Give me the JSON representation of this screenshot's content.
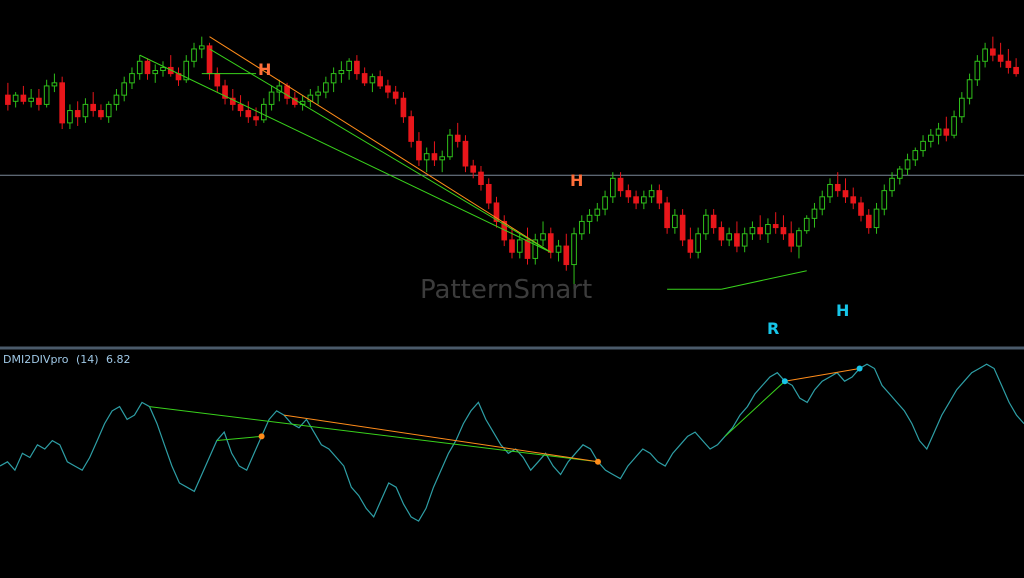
{
  "indicator": {
    "name": "DMI2DIVpro",
    "period": "(14)",
    "value": "6.82"
  },
  "watermark": "PatternSmart",
  "colors": {
    "background": "#000000",
    "bull": "#2fbf1a",
    "bear": "#e8161b",
    "trendline": "#39d21c",
    "trendline_alt": "#ff8c1a",
    "signal_h_top": "#ff6e3a",
    "signal_bottom": "#17c5e8",
    "indicator_line": "#2e9fa6",
    "separator": "#4a5a6a",
    "hline": "#7a8898"
  },
  "signals": [
    {
      "label": "H",
      "color": "orange"
    },
    {
      "label": "H",
      "color": "orange"
    },
    {
      "label": "R",
      "color": "cyan"
    },
    {
      "label": "H",
      "color": "cyan"
    }
  ],
  "chart_data": [
    {
      "type": "candlestick",
      "title": "",
      "xlabel": "",
      "ylabel": "",
      "ylim": [
        0,
        100
      ],
      "horizontal_line": 47,
      "grid": false,
      "candles": [
        [
          73,
          77,
          68,
          70
        ],
        [
          71,
          74,
          69,
          73
        ],
        [
          73,
          76,
          70,
          71
        ],
        [
          71,
          75,
          69,
          72
        ],
        [
          72,
          75,
          68,
          70
        ],
        [
          70,
          78,
          69,
          76
        ],
        [
          76,
          80,
          74,
          77
        ],
        [
          77,
          79,
          62,
          64
        ],
        [
          64,
          70,
          62,
          68
        ],
        [
          68,
          71,
          63,
          66
        ],
        [
          66,
          72,
          64,
          70
        ],
        [
          70,
          74,
          66,
          68
        ],
        [
          68,
          70,
          65,
          66
        ],
        [
          66,
          71,
          64,
          70
        ],
        [
          70,
          75,
          68,
          73
        ],
        [
          73,
          79,
          71,
          77
        ],
        [
          77,
          82,
          75,
          80
        ],
        [
          80,
          86,
          78,
          84
        ],
        [
          84,
          85,
          78,
          80
        ],
        [
          80,
          83,
          77,
          81
        ],
        [
          81,
          84,
          79,
          82
        ],
        [
          82,
          86,
          79,
          80
        ],
        [
          80,
          82,
          76,
          78
        ],
        [
          78,
          86,
          77,
          84
        ],
        [
          84,
          90,
          82,
          88
        ],
        [
          88,
          92,
          85,
          89
        ],
        [
          89,
          90,
          78,
          80
        ],
        [
          80,
          82,
          74,
          76
        ],
        [
          76,
          78,
          70,
          72
        ],
        [
          72,
          75,
          68,
          70
        ],
        [
          70,
          73,
          66,
          68
        ],
        [
          68,
          71,
          64,
          66
        ],
        [
          66,
          69,
          63,
          65
        ],
        [
          65,
          72,
          64,
          70
        ],
        [
          70,
          76,
          68,
          74
        ],
        [
          74,
          78,
          71,
          76
        ],
        [
          76,
          77,
          70,
          72
        ],
        [
          72,
          74,
          69,
          70
        ],
        [
          70,
          73,
          68,
          71
        ],
        [
          71,
          75,
          69,
          73
        ],
        [
          73,
          76,
          70,
          74
        ],
        [
          74,
          79,
          72,
          77
        ],
        [
          77,
          82,
          74,
          80
        ],
        [
          80,
          84,
          77,
          81
        ],
        [
          81,
          85,
          78,
          84
        ],
        [
          84,
          86,
          78,
          80
        ],
        [
          80,
          82,
          76,
          77
        ],
        [
          77,
          80,
          74,
          79
        ],
        [
          79,
          81,
          75,
          76
        ],
        [
          76,
          78,
          72,
          74
        ],
        [
          74,
          76,
          70,
          72
        ],
        [
          72,
          74,
          64,
          66
        ],
        [
          66,
          68,
          56,
          58
        ],
        [
          58,
          61,
          50,
          52
        ],
        [
          52,
          56,
          48,
          54
        ],
        [
          54,
          58,
          50,
          52
        ],
        [
          52,
          55,
          48,
          53
        ],
        [
          53,
          62,
          52,
          60
        ],
        [
          60,
          64,
          56,
          58
        ],
        [
          58,
          60,
          48,
          50
        ],
        [
          50,
          52,
          46,
          48
        ],
        [
          48,
          50,
          42,
          44
        ],
        [
          44,
          46,
          36,
          38
        ],
        [
          38,
          40,
          30,
          32
        ],
        [
          32,
          34,
          24,
          26
        ],
        [
          26,
          30,
          20,
          22
        ],
        [
          22,
          28,
          20,
          26
        ],
        [
          26,
          30,
          18,
          20
        ],
        [
          20,
          28,
          18,
          26
        ],
        [
          26,
          32,
          24,
          28
        ],
        [
          28,
          30,
          20,
          22
        ],
        [
          22,
          26,
          19,
          24
        ],
        [
          24,
          28,
          16,
          18
        ],
        [
          18,
          30,
          10,
          28
        ],
        [
          28,
          34,
          26,
          32
        ],
        [
          32,
          36,
          28,
          34
        ],
        [
          34,
          38,
          32,
          36
        ],
        [
          36,
          42,
          34,
          40
        ],
        [
          40,
          48,
          38,
          46
        ],
        [
          46,
          48,
          40,
          42
        ],
        [
          42,
          44,
          38,
          40
        ],
        [
          40,
          42,
          36,
          38
        ],
        [
          38,
          42,
          36,
          40
        ],
        [
          40,
          44,
          38,
          42
        ],
        [
          42,
          44,
          36,
          38
        ],
        [
          38,
          40,
          28,
          30
        ],
        [
          30,
          36,
          28,
          34
        ],
        [
          34,
          36,
          24,
          26
        ],
        [
          26,
          30,
          20,
          22
        ],
        [
          22,
          30,
          20,
          28
        ],
        [
          28,
          36,
          26,
          34
        ],
        [
          34,
          36,
          28,
          30
        ],
        [
          30,
          32,
          24,
          26
        ],
        [
          26,
          30,
          24,
          28
        ],
        [
          28,
          32,
          22,
          24
        ],
        [
          24,
          30,
          22,
          28
        ],
        [
          28,
          32,
          26,
          30
        ],
        [
          30,
          34,
          26,
          28
        ],
        [
          28,
          33,
          25,
          31
        ],
        [
          31,
          35,
          28,
          30
        ],
        [
          30,
          34,
          26,
          28
        ],
        [
          28,
          32,
          22,
          24
        ],
        [
          24,
          30,
          20,
          29
        ],
        [
          29,
          34,
          28,
          33
        ],
        [
          33,
          38,
          30,
          36
        ],
        [
          36,
          42,
          34,
          40
        ],
        [
          40,
          46,
          38,
          44
        ],
        [
          44,
          48,
          40,
          42
        ],
        [
          42,
          46,
          38,
          40
        ],
        [
          40,
          43,
          36,
          38
        ],
        [
          38,
          40,
          32,
          34
        ],
        [
          34,
          36,
          28,
          30
        ],
        [
          30,
          38,
          28,
          36
        ],
        [
          36,
          44,
          34,
          42
        ],
        [
          42,
          48,
          40,
          46
        ],
        [
          46,
          50,
          44,
          49
        ],
        [
          49,
          54,
          47,
          52
        ],
        [
          52,
          56,
          50,
          55
        ],
        [
          55,
          60,
          53,
          58
        ],
        [
          58,
          62,
          56,
          60
        ],
        [
          60,
          64,
          57,
          62
        ],
        [
          62,
          66,
          58,
          60
        ],
        [
          60,
          68,
          59,
          66
        ],
        [
          66,
          74,
          64,
          72
        ],
        [
          72,
          80,
          70,
          78
        ],
        [
          78,
          86,
          76,
          84
        ],
        [
          84,
          90,
          82,
          88
        ],
        [
          88,
          92,
          84,
          86
        ],
        [
          86,
          90,
          82,
          84
        ],
        [
          84,
          88,
          80,
          82
        ],
        [
          82,
          85,
          79,
          80
        ]
      ]
    },
    {
      "type": "line",
      "title": "",
      "xlabel": "",
      "ylabel": "",
      "ylim": [
        0,
        100
      ],
      "grid": false,
      "series": [
        {
          "values": [
            50,
            52,
            48,
            56,
            54,
            60,
            58,
            62,
            60,
            52,
            50,
            48,
            54,
            62,
            70,
            76,
            78,
            72,
            74,
            80,
            78,
            70,
            60,
            50,
            42,
            40,
            38,
            46,
            54,
            62,
            66,
            56,
            50,
            48,
            56,
            64,
            72,
            76,
            74,
            70,
            68,
            72,
            66,
            60,
            58,
            54,
            50,
            40,
            36,
            30,
            26,
            34,
            42,
            40,
            32,
            26,
            24,
            30,
            40,
            48,
            56,
            62,
            70,
            76,
            80,
            72,
            66,
            60,
            56,
            58,
            54,
            48,
            52,
            56,
            50,
            46,
            52,
            56,
            60,
            58,
            52,
            48,
            46,
            44,
            50,
            54,
            58,
            56,
            52,
            50,
            56,
            60,
            64,
            66,
            62,
            58,
            60,
            64,
            68,
            74,
            78,
            84,
            88,
            92,
            94,
            90,
            88,
            82,
            80,
            86,
            90,
            92,
            94,
            90,
            92,
            96,
            98,
            96,
            88,
            84,
            80,
            76,
            70,
            62,
            58,
            66,
            74,
            80,
            86,
            90,
            94,
            96,
            98,
            96,
            88,
            80,
            74,
            70
          ]
        }
      ]
    }
  ]
}
